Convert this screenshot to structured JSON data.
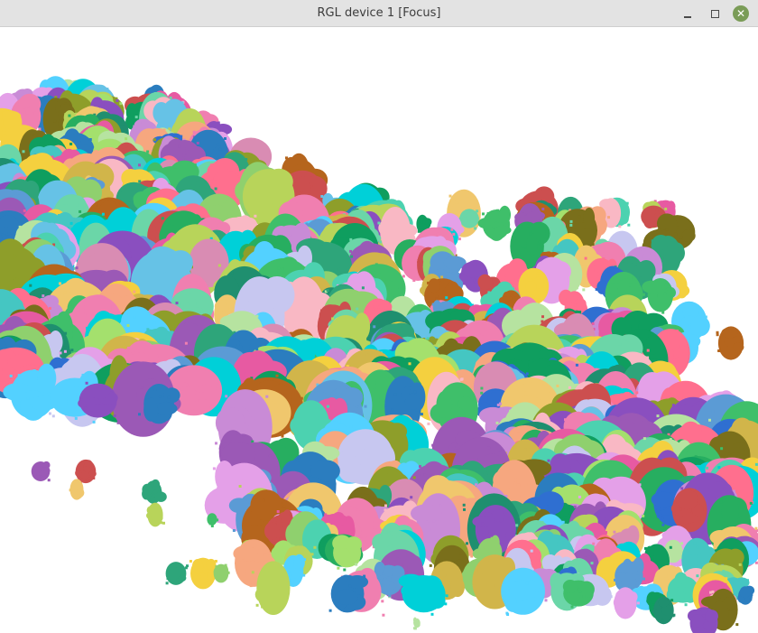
{
  "window": {
    "title": "RGL device 1 [Focus]",
    "buttons": {
      "minimize": "minimize",
      "maximize": "maximize",
      "close": "✕"
    }
  },
  "scene": {
    "kind": "3d point cloud — segmented trees (rgl)",
    "background": "#ffffff",
    "palette": [
      "#f07fb0",
      "#3fbf6a",
      "#8fd06e",
      "#f6a77f",
      "#c98bd6",
      "#5b9bd5",
      "#f0c76d",
      "#7a6f1b",
      "#45c6c2",
      "#e75aa2",
      "#1f8f6f",
      "#b8d45a",
      "#9b59b6",
      "#00d0d8",
      "#f4d03f",
      "#2ea57a",
      "#d98cb3",
      "#6bd6a8",
      "#8a4fbf",
      "#2f6fd1",
      "#c7c7f0",
      "#b5651d",
      "#27ae60",
      "#ff6f8e",
      "#a4e06d",
      "#66c2e6",
      "#d1b54a",
      "#4cd2b0",
      "#e4a0e8",
      "#0f9e5f",
      "#cc4f4f",
      "#8e9e2a",
      "#53d1ff",
      "#b6e3a0",
      "#f9b8c4",
      "#2b7dbf"
    ]
  }
}
